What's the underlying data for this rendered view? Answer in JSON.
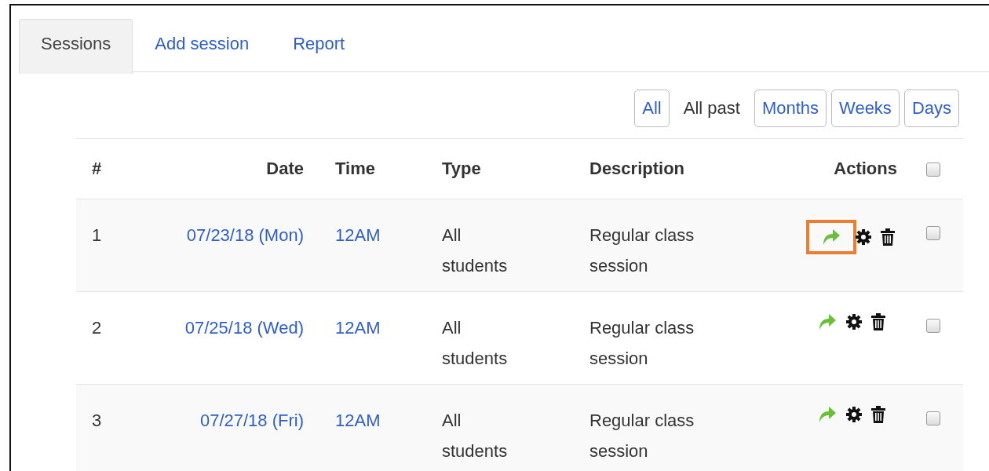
{
  "tabs": [
    {
      "label": "Sessions",
      "selected": true
    },
    {
      "label": "Add session",
      "selected": false
    },
    {
      "label": "Report",
      "selected": false
    }
  ],
  "filters": [
    {
      "label": "All",
      "selected": false
    },
    {
      "label": "All past",
      "selected": true
    },
    {
      "label": "Months",
      "selected": false
    },
    {
      "label": "Weeks",
      "selected": false
    },
    {
      "label": "Days",
      "selected": false
    }
  ],
  "table": {
    "columns": [
      "#",
      "Date",
      "Time",
      "Type",
      "Description",
      "Actions"
    ],
    "select_all_checked": false,
    "rows": [
      {
        "number": "1",
        "date": "07/23/18 (Mon)",
        "time": "12AM",
        "type": "All students",
        "description": "Regular class session",
        "checked": false,
        "highlighted": true
      },
      {
        "number": "2",
        "date": "07/25/18 (Wed)",
        "time": "12AM",
        "type": "All students",
        "description": "Regular class session",
        "checked": false,
        "highlighted": false
      },
      {
        "number": "3",
        "date": "07/27/18 (Fri)",
        "time": "12AM",
        "type": "All students",
        "description": "Regular class session",
        "checked": false,
        "highlighted": false
      }
    ]
  }
}
